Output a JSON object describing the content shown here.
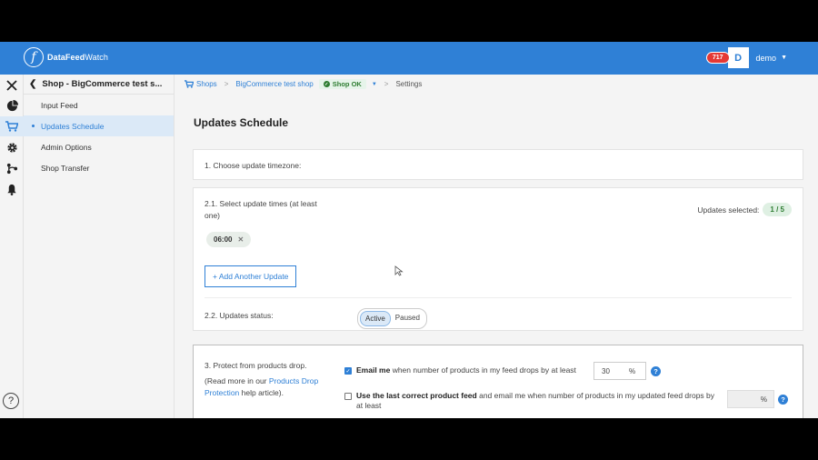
{
  "header": {
    "logo_mark": "f",
    "logo_bold": "DataFeed",
    "logo_light": "Watch",
    "notification_count": "717",
    "avatar_letter": "D",
    "user_name": "demo"
  },
  "sidebar": {
    "shop_title": "Shop - BigCommerce test s...",
    "items": [
      {
        "label": "Input Feed"
      },
      {
        "label": "Updates Schedule"
      },
      {
        "label": "Admin Options"
      },
      {
        "label": "Shop Transfer"
      }
    ]
  },
  "breadcrumb": {
    "shops": "Shops",
    "shop_name": "BigCommerce test shop",
    "status": "Shop OK",
    "current": "Settings"
  },
  "page": {
    "title": "Updates Schedule"
  },
  "timezone": {
    "label": "1. Choose update timezone:"
  },
  "times": {
    "label": "2.1. Select update times (at least one)",
    "selected_label": "Updates selected:",
    "selected_count": "1 / 5",
    "chips": [
      "06:00"
    ],
    "add_button": "+ Add Another Update",
    "status_label": "2.2. Updates status:",
    "status_options": [
      "Active",
      "Paused"
    ],
    "status_selected": "Active"
  },
  "protect": {
    "label": "3. Protect from products drop.",
    "read_more_pre": "(Read more in our ",
    "read_more_link": "Products Drop Protection",
    "read_more_post": " help article).",
    "option1_bold": "Email me",
    "option1_text": " when number of products in my feed drops by at least",
    "option1_value": "30",
    "option1_unit": "%",
    "option1_checked": true,
    "option2_bold": "Use the last correct product feed",
    "option2_text": " and email me when number of products in my updated feed drops by at least",
    "option2_value": "",
    "option2_unit": "%",
    "option2_checked": false
  },
  "colors": {
    "brand_blue": "#2f80d6",
    "badge_red": "#e53935",
    "ok_green": "#2e7d32"
  },
  "icons": [
    "close-icon",
    "pie-chart-icon",
    "cart-icon",
    "gear-icon",
    "flow-icon",
    "bell-icon",
    "help-icon"
  ]
}
